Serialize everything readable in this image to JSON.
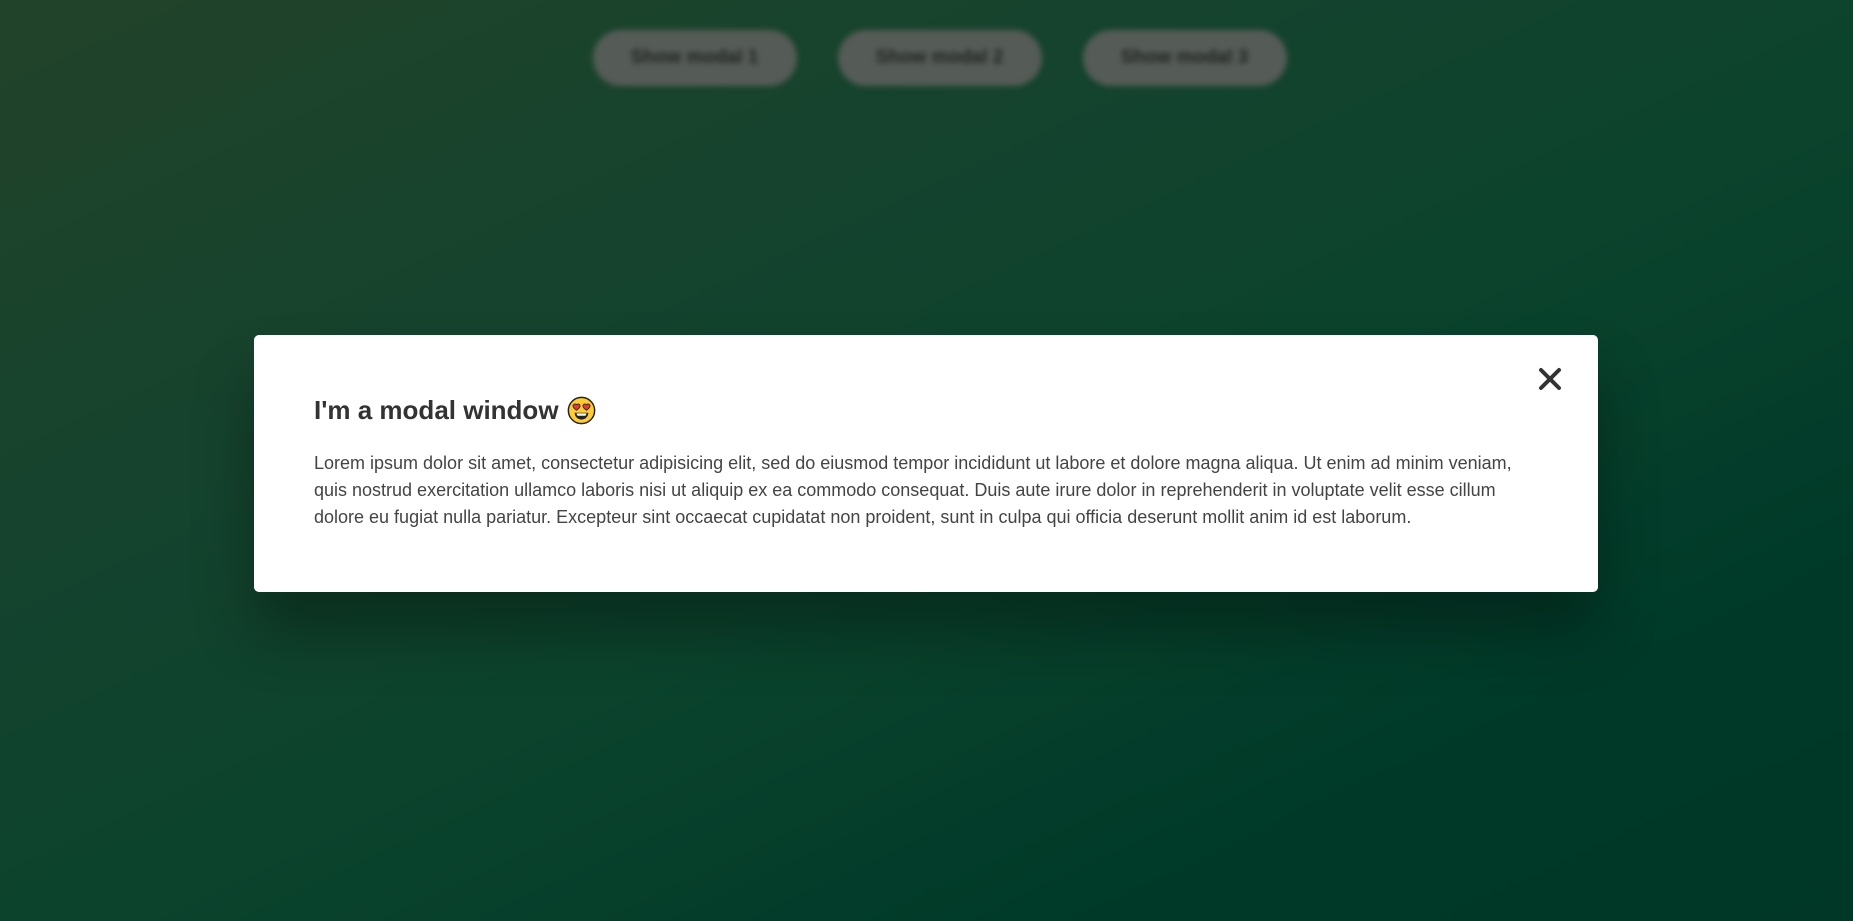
{
  "page": {
    "open_buttons": [
      {
        "label": "Show modal 1"
      },
      {
        "label": "Show modal 2"
      },
      {
        "label": "Show modal 3"
      }
    ]
  },
  "modal": {
    "title": "I'm a modal window",
    "title_emoji": "smiling-face-with-heart-eyes-icon",
    "body": "Lorem ipsum dolor sit amet, consectetur adipisicing elit, sed do eiusmod tempor incididunt ut labore et dolore magna aliqua. Ut enim ad minim veniam, quis nostrud exercitation ullamco laboris nisi ut aliquip ex ea commodo consequat. Duis aute irure dolor in reprehenderit in voluptate velit esse cillum dolore eu fugiat nulla pariatur. Excepteur sint occaecat cupidatat non proident, sunt in culpa qui officia deserunt mollit anim id est laborum.",
    "close_icon": "close-icon"
  },
  "colors": {
    "background_start": "#2d5a37",
    "background_end": "#004a35",
    "modal_background": "#ffffff",
    "title_text": "#333333",
    "body_text": "#444444",
    "button_background": "#727a74"
  }
}
